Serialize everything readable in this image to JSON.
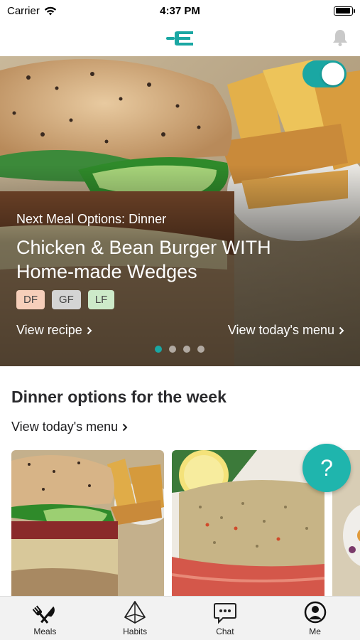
{
  "status_bar": {
    "carrier": "Carrier",
    "time": "4:37 PM",
    "battery_level": 0.95
  },
  "header": {
    "logo_icon": "fork-logo-icon",
    "bell_icon": "bell-icon",
    "accent_color": "#1aa7a3"
  },
  "hero": {
    "kicker": "Next Meal Options: Dinner",
    "title": "Chicken & Bean Burger WITH Home-made Wedges",
    "toggle_on": true,
    "tags": [
      {
        "label": "DF",
        "color": "#f6cfba"
      },
      {
        "label": "GF",
        "color": "#d4d4d4"
      },
      {
        "label": "LF",
        "color": "#cdeac9"
      }
    ],
    "view_recipe": "View recipe",
    "view_menu": "View today's menu",
    "page_count": 4,
    "active_page": 1
  },
  "section": {
    "title": "Dinner options for the week",
    "link": "View today's menu"
  },
  "help_button": {
    "label": "?"
  },
  "tabs": [
    {
      "label": "Meals",
      "icon": "fork-knife-icon"
    },
    {
      "label": "Habits",
      "icon": "pyramid-icon"
    },
    {
      "label": "Chat",
      "icon": "chat-bubble-icon"
    },
    {
      "label": "Me",
      "icon": "user-circle-icon"
    }
  ]
}
